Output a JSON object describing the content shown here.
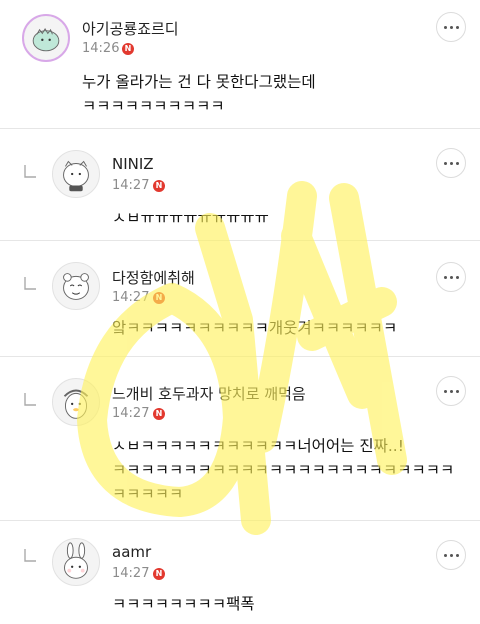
{
  "comments": [
    {
      "nickname": "아기공룡죠르디",
      "time": "14:26",
      "badge": "N",
      "text": "누가 올라가는 건 다 못한다그랬는데\nㅋㅋㅋㅋㅋㅋㅋㅋㅋㅋ"
    },
    {
      "nickname": "NINIZ",
      "time": "14:27",
      "badge": "N",
      "text": "ㅅㅂㅠㅠㅠㅠㅠㅠㅠㅠㅠ"
    },
    {
      "nickname": "다정함에취해",
      "time": "14:27",
      "badge": "N",
      "text": "앜ㅋㅋㅋㅋㅋㅋㅋㅋㅋㅋ개웃겨ㅋㅋㅋㅋㅋㅋ"
    },
    {
      "nickname": "느개비 호두과자 망치로 깨먹음",
      "time": "14:27",
      "badge": "N",
      "text": "ㅅㅂㅋㅋㅋㅋㅋㅋㅋㅋㅋㅋㅋ너어어는 진짜..!\nㅋㅋㅋㅋㅋㅋㅋㅋㅋㅋㅋㅋㅋㅋㅋㅋㅋㅋㅋㅋㅋㅋㅋㅋ\nㅋㅋㅋㅋㅋ"
    },
    {
      "nickname": "aamr",
      "time": "14:27",
      "badge": "N",
      "text": "ㅋㅋㅋㅋㅋㅋㅋㅋ팩폭"
    }
  ],
  "watermark": "머시",
  "colors": {
    "badge": "#e2392f",
    "watermark": "#fff25a",
    "divider": "#e6e6e6"
  }
}
